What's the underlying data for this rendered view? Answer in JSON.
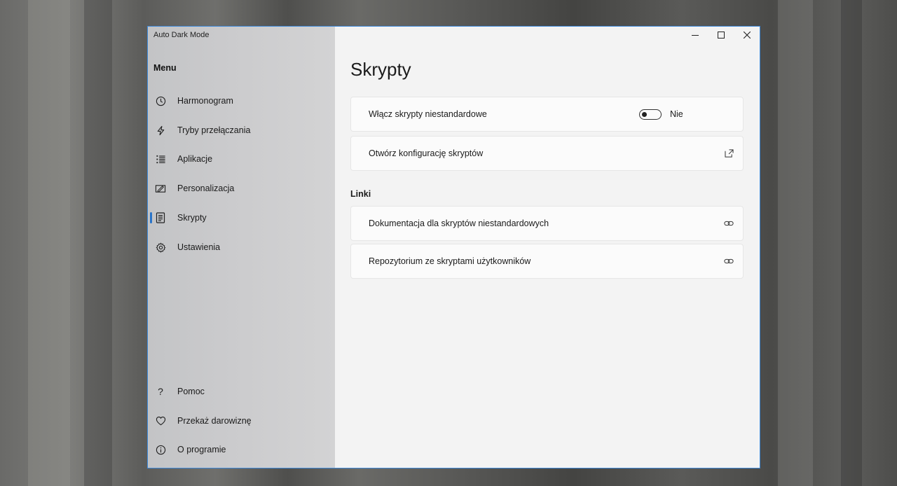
{
  "window": {
    "title": "Auto Dark Mode"
  },
  "sidebar": {
    "menu_title": "Menu",
    "items": [
      {
        "label": "Harmonogram",
        "icon": "clock-icon"
      },
      {
        "label": "Tryby przełączania",
        "icon": "lightning-icon"
      },
      {
        "label": "Aplikacje",
        "icon": "list-icon"
      },
      {
        "label": "Personalizacja",
        "icon": "personalize-icon"
      },
      {
        "label": "Skrypty",
        "icon": "document-icon",
        "active": true
      },
      {
        "label": "Ustawienia",
        "icon": "gear-icon"
      }
    ],
    "footer_items": [
      {
        "label": "Pomoc",
        "icon": "question-icon"
      },
      {
        "label": "Przekaż darowiznę",
        "icon": "heart-icon"
      },
      {
        "label": "O programie",
        "icon": "info-icon"
      }
    ]
  },
  "main": {
    "title": "Skrypty",
    "enable_scripts": {
      "label": "Włącz skrypty niestandardowe",
      "state_text": "Nie",
      "enabled": false
    },
    "open_config": {
      "label": "Otwórz konfigurację skryptów",
      "icon": "open-external-icon"
    },
    "links_section": {
      "title": "Linki",
      "items": [
        {
          "label": "Dokumentacja dla skryptów niestandardowych",
          "icon": "link-icon"
        },
        {
          "label": "Repozytorium ze skryptami użytkowników",
          "icon": "link-icon"
        }
      ]
    }
  },
  "colors": {
    "accent": "#2a74c8",
    "window_border": "#3b86d6"
  }
}
